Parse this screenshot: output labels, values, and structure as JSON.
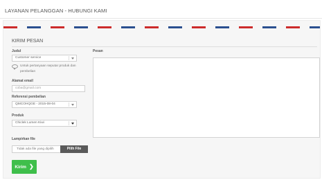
{
  "header": {
    "title": "LAYANAN PELANGGAN - HUBUNGI KAMI"
  },
  "section": {
    "title": "KIRIM PESAN"
  },
  "form": {
    "subject": {
      "label": "Judul",
      "value": "Customer service",
      "hint": "Untuk pertanyaan seputar produk dan pembelian"
    },
    "email": {
      "label": "Alamat email",
      "placeholder": "coba@gmail.com"
    },
    "order_ref": {
      "label": "Referensi pembelian",
      "value": "QMCOHQGE - 2015-08-04"
    },
    "product": {
      "label": "Produk",
      "value": "Chiclek Lumen Kiwi"
    },
    "attachment": {
      "label": "Lampirkan file",
      "status": "Tidak ada file yang dipilih",
      "button": "Pilih File"
    },
    "message": {
      "label": "Pesan"
    },
    "submit": {
      "label": "Kirim",
      "icon": "chevron-right-icon"
    }
  },
  "colors": {
    "submit": "#3fbf4b",
    "airmail_red": "#cc2b2b",
    "airmail_blue": "#2a4f8f"
  }
}
